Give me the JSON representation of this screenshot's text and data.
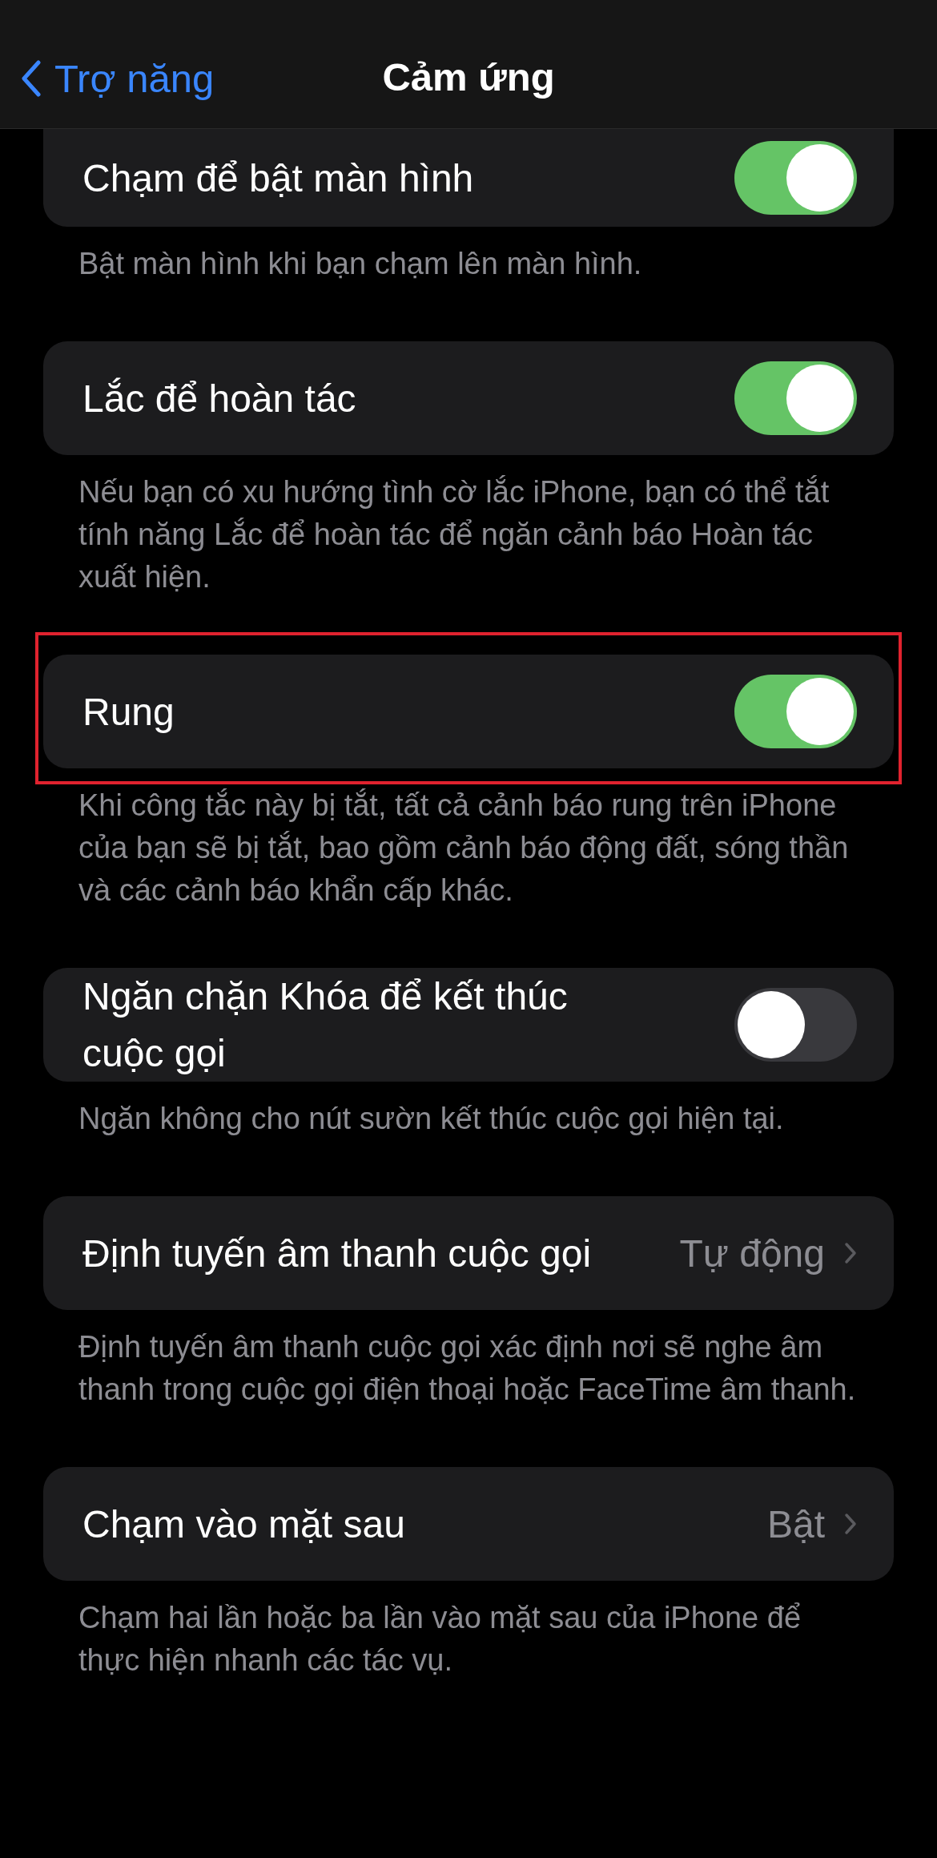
{
  "nav": {
    "back": "Trợ năng",
    "title": "Cảm ứng"
  },
  "sections": [
    {
      "kind": "toggle",
      "label": "Chạm để bật màn hình",
      "on": true,
      "highlighted": false,
      "footer": "Bật màn hình khi bạn chạm lên màn hình."
    },
    {
      "kind": "toggle",
      "label": "Lắc để hoàn tác",
      "on": true,
      "highlighted": false,
      "footer": "Nếu bạn có xu hướng tình cờ lắc iPhone, bạn có thể tắt tính năng Lắc để hoàn tác để ngăn cảnh báo Hoàn tác xuất hiện."
    },
    {
      "kind": "toggle",
      "label": "Rung",
      "on": true,
      "highlighted": true,
      "footer": "Khi công tắc này bị tắt, tất cả cảnh báo rung trên iPhone của bạn sẽ bị tắt, bao gồm cảnh báo động đất, sóng thần và các cảnh báo khẩn cấp khác."
    },
    {
      "kind": "toggle",
      "label": "Ngăn chặn Khóa để kết thúc cuộc gọi",
      "on": false,
      "highlighted": false,
      "footer": "Ngăn không cho nút sườn kết thúc cuộc gọi hiện tại."
    },
    {
      "kind": "value",
      "label": "Định tuyến âm thanh cuộc gọi",
      "value": "Tự động",
      "highlighted": false,
      "footer": "Định tuyến âm thanh cuộc gọi xác định nơi sẽ nghe âm thanh trong cuộc gọi điện thoại hoặc FaceTime âm thanh."
    },
    {
      "kind": "value",
      "label": "Chạm vào mặt sau",
      "value": "Bật",
      "highlighted": false,
      "footer": "Chạm hai lần hoặc ba lần vào mặt sau của iPhone để thực hiện nhanh các tác vụ."
    }
  ]
}
